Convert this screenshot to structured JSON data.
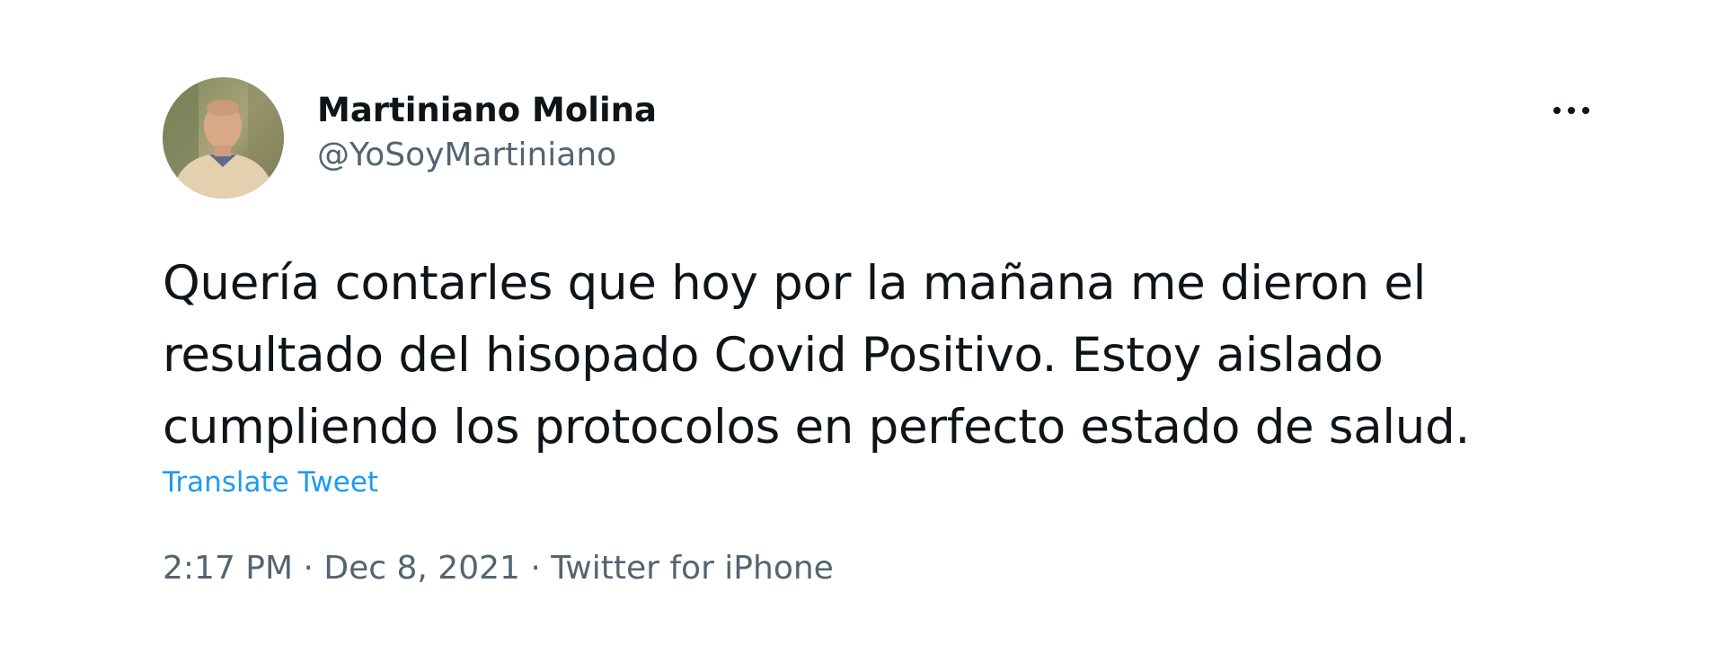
{
  "tweet": {
    "author": {
      "display_name": "Martiniano Molina",
      "handle": "@YoSoyMartiniano",
      "avatar_icon": "profile-photo"
    },
    "more_icon": "more-horizontal-icon",
    "text": "Quería contarles que hoy por la mañana me dieron el\nresultado del hisopado Covid Positivo. Estoy aislado\ncumpliendo los protocolos en perfecto estado de salud.",
    "translate_label": "Translate Tweet",
    "meta": {
      "time": "2:17 PM",
      "separator": " · ",
      "date": "Dec 8, 2021",
      "source": "Twitter for iPhone"
    }
  },
  "colors": {
    "text_primary": "#0f1419",
    "text_secondary": "#536471",
    "link": "#1d9bf0",
    "background": "#ffffff"
  }
}
